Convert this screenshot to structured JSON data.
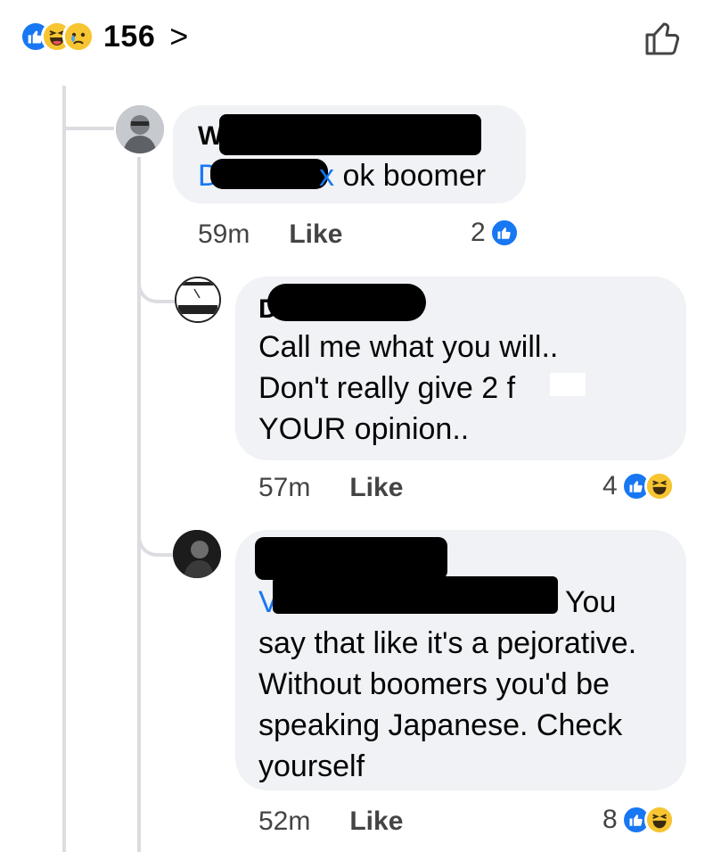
{
  "header": {
    "reactions": [
      "like-icon",
      "haha-icon",
      "sad-icon"
    ],
    "reaction_count": "156",
    "chevron": ">"
  },
  "comments": [
    {
      "name_initial": "W",
      "mention_initial": "D",
      "mention_tail": "x",
      "text": " ok boomer",
      "time": "59m",
      "like_label": "Like",
      "reaction_count": "2",
      "reactions": [
        "like-icon"
      ]
    },
    {
      "name_initial": "D",
      "lines": [
        "Call me what you will..",
        "Don't really give 2 f",
        "YOUR opinion.."
      ],
      "time": "57m",
      "like_label": "Like",
      "reaction_count": "4",
      "reactions": [
        "like-icon",
        "haha-icon"
      ]
    },
    {
      "mention_initial": "V",
      "mention_end": "You",
      "lines": [
        "say that like it's a pejorative.",
        "Without boomers you'd be",
        "speaking Japanese. Check",
        "yourself"
      ],
      "time": "52m",
      "like_label": "Like",
      "reaction_count": "8",
      "reactions": [
        "like-icon",
        "haha-icon"
      ]
    }
  ],
  "colors": {
    "accent": "#1877f2",
    "bubble": "#f0f2f5",
    "thread_line": "#dcdde1",
    "emoji_yellow": "#f7c531"
  }
}
